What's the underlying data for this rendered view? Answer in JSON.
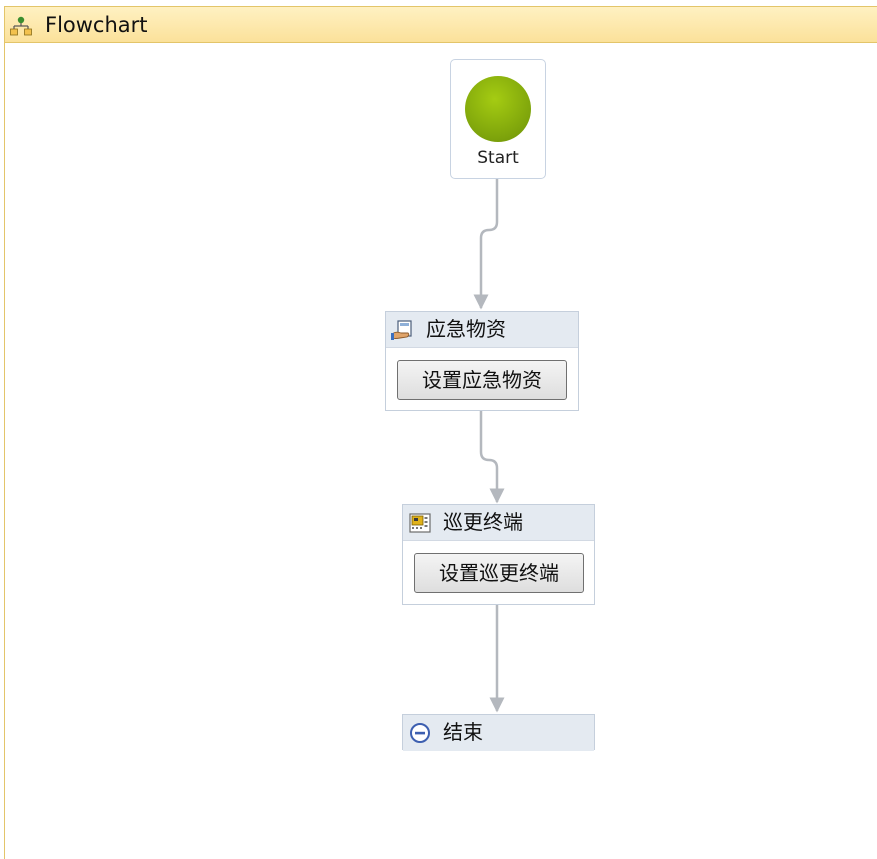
{
  "header": {
    "title": "Flowchart",
    "icon": "flowchart-icon"
  },
  "start": {
    "label": "Start"
  },
  "activities": [
    {
      "title": "应急物资",
      "icon": "hand-card-icon",
      "button_label": "设置应急物资"
    },
    {
      "title": "巡更终端",
      "icon": "terminal-icon",
      "button_label": "设置巡更终端"
    }
  ],
  "end": {
    "title": "结束",
    "icon": "minus-circle-icon"
  },
  "colors": {
    "header_bg": "#fbe19a",
    "connector": "#b4b8be",
    "start_green": "#8bb30c",
    "activity_head": "#e4eaf1"
  }
}
